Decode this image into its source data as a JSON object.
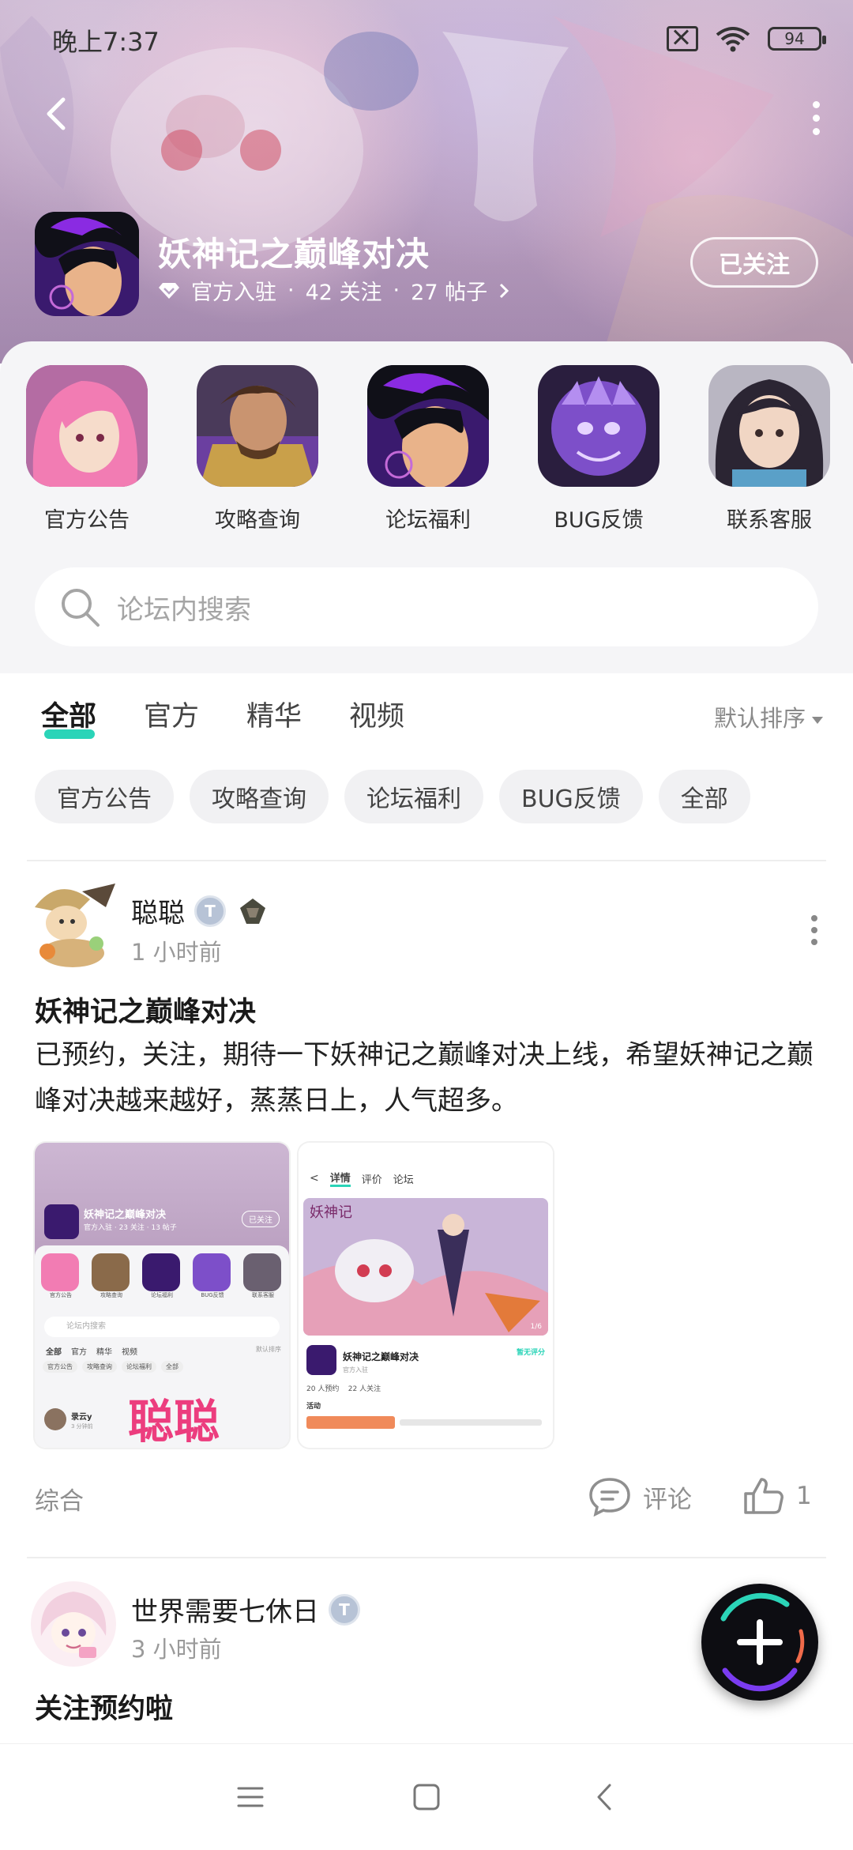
{
  "status_bar": {
    "time": "晚上7:37",
    "battery": "94"
  },
  "header": {
    "game_title": "妖神记之巅峰对决",
    "official_label": "官方入驻",
    "followers": "42 关注",
    "posts": "27 帖子",
    "follow_button": "已关注"
  },
  "shortcuts": [
    {
      "label": "官方公告"
    },
    {
      "label": "攻略查询"
    },
    {
      "label": "论坛福利"
    },
    {
      "label": "BUG反馈"
    },
    {
      "label": "联系客服"
    }
  ],
  "search": {
    "placeholder": "论坛内搜索"
  },
  "tabs": [
    {
      "label": "全部",
      "active": true
    },
    {
      "label": "官方"
    },
    {
      "label": "精华"
    },
    {
      "label": "视频"
    }
  ],
  "sort_label": "默认排序",
  "chips": [
    "官方公告",
    "攻略查询",
    "论坛福利",
    "BUG反馈",
    "全部"
  ],
  "posts": [
    {
      "username": "聪聪",
      "time": "1 小时前",
      "title": "妖神记之巅峰对决",
      "body": "已预约，关注，期待一下妖神记之巅峰对决上线，希望妖神记之巅峰对决越来越好，蒸蒸日上，人气超多。",
      "thumb1": {
        "title": "妖神记之巅峰对决",
        "meta": "官方入驻 · 23 关注 · 13 帖子",
        "follow": "已关注",
        "labels": [
          "官方公告",
          "攻略查询",
          "论坛福利",
          "BUG反馈",
          "联系客服"
        ],
        "search": "论坛内搜索",
        "tabs": [
          "全部",
          "官方",
          "精华",
          "视频"
        ],
        "sort": "默认排序",
        "chips": [
          "官方公告",
          "攻略查询",
          "论坛福利",
          "全部"
        ],
        "user": "录云y",
        "user_time": "3 分钟前",
        "overlay": "聪聪"
      },
      "thumb2": {
        "tabs": [
          "详情",
          "评价",
          "论坛"
        ],
        "page": "1/6",
        "title": "妖神记之巅峰对决",
        "rating": "暂无评分",
        "official": "官方入驻",
        "stats": "20 人预约    22 人关注",
        "activity": "活动"
      },
      "tag": "综合",
      "comment_label": "评论",
      "likes": "1"
    },
    {
      "username": "世界需要七休日",
      "time": "3 小时前",
      "title": "关注预约啦"
    }
  ],
  "colors": {
    "accent": "#2bd4b8",
    "fab": "#0d0d12"
  }
}
